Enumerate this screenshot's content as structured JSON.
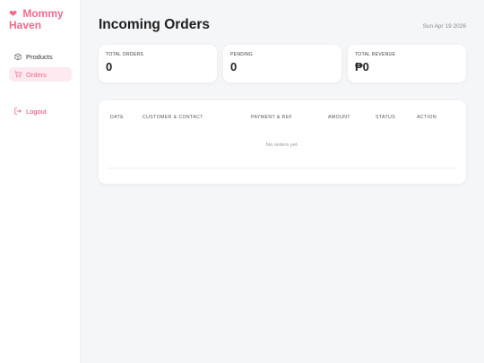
{
  "brand": {
    "name_line1": "Mommy",
    "name_line2": "Haven",
    "icon": "heart-icon",
    "color": "#f06a8c"
  },
  "sidebar": {
    "items": [
      {
        "label": "Products",
        "icon": "box-icon",
        "active": false
      },
      {
        "label": "Orders",
        "icon": "cart-icon",
        "active": true
      }
    ],
    "logout": {
      "label": "Logout",
      "icon": "logout-icon"
    }
  },
  "header": {
    "title": "Incoming Orders",
    "date": "Sun Apr 19 2026"
  },
  "stats": [
    {
      "label": "TOTAL ORDERS",
      "value": "0"
    },
    {
      "label": "PENDING",
      "value": "0"
    },
    {
      "label": "TOTAL REVENUE",
      "value": "₱0"
    }
  ],
  "orders_table": {
    "columns": [
      "DATE",
      "CUSTOMER & CONTACT",
      "PAYMENT & REF",
      "AMOUNT",
      "STATUS",
      "ACTION"
    ],
    "rows": [],
    "empty_message": "No orders yet."
  },
  "colors": {
    "accent": "#f06a8c",
    "active_bg": "#fde9ef",
    "logout": "#e2436f",
    "page_bg": "#f5f6f8"
  }
}
